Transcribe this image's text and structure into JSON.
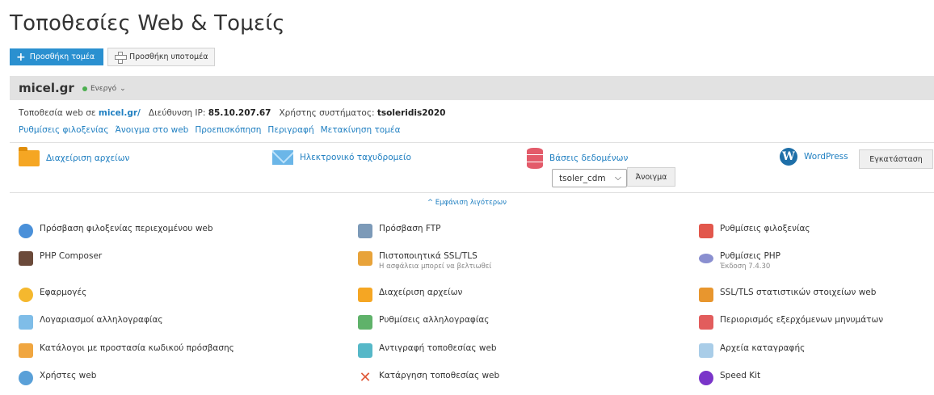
{
  "page": {
    "title": "Τοποθεσίες Web & Τομείς"
  },
  "actions": {
    "add_domain": "Προσθήκη τομέα",
    "add_subdomain": "Προσθήκη υποτομέα"
  },
  "domain": {
    "name": "micel.gr",
    "status": "Ενεργό",
    "status_caret": "⌄",
    "info": {
      "site_prefix": "Τοποθεσία web σε ",
      "site_link": "micel.gr/",
      "ip_label": "Διεύθυνση IP:",
      "ip_value": "85.10.207.67",
      "user_label": "Χρήστης συστήματος:",
      "user_value": "tsoleridis2020"
    },
    "links": [
      "Ρυθμίσεις φιλοξενίας",
      "Άνοιγμα στο web",
      "Προεπισκόπηση",
      "Περιγραφή",
      "Μετακίνηση τομέα"
    ]
  },
  "features": {
    "file_manager": "Διαχείριση αρχείων",
    "mail": "Ηλεκτρονικό ταχυδρομείο",
    "databases": "Βάσεις δεδομένων",
    "db_select_value": "tsoler_cdm",
    "db_open": "Άνοιγμα",
    "wordpress": "WordPress",
    "wp_install": "Εγκατάσταση"
  },
  "show_less": "^ Εμφάνιση λιγότερων",
  "tools": {
    "col1": [
      "Πρόσβαση φιλοξενίας περιεχομένου web",
      "PHP Composer",
      "Εφαρμογές",
      "Λογαριασμοί αλληλογραφίας",
      "Κατάλογοι με προστασία κωδικού πρόσβασης",
      "Χρήστες web"
    ],
    "col2": [
      "Πρόσβαση FTP",
      "Πιστοποιητικά SSL/TLS",
      "Διαχείριση αρχείων",
      "Ρυθμίσεις αλληλογραφίας",
      "Αντιγραφή τοποθεσίας web",
      "Κατάργηση τοποθεσίας web"
    ],
    "col2_ssl_note": "Η ασφάλεια μπορεί να βελτιωθεί",
    "col3": [
      "Ρυθμίσεις φιλοξενίας",
      "Ρυθμίσεις PHP",
      "SSL/TLS στατιστικών στοιχείων web",
      "Περιορισμός εξερχόμενων μηνυμάτων",
      "Αρχεία καταγραφής",
      "Speed Kit"
    ],
    "col3_php_note": "Έκδοση 7.4.30"
  },
  "colors": {
    "accent": "#2a90d0",
    "link": "#1f7fc1",
    "active": "#4caf50"
  }
}
